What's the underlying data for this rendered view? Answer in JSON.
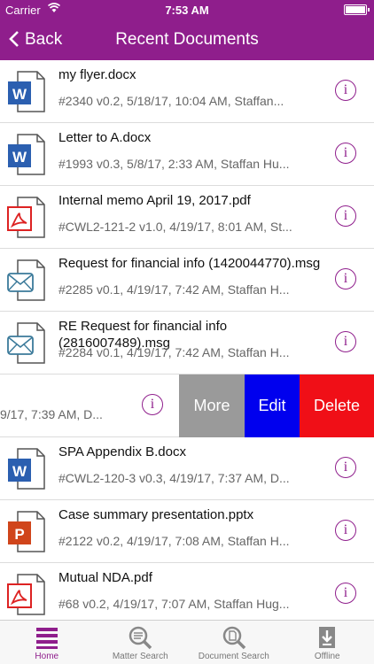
{
  "status_bar": {
    "carrier": "Carrier",
    "time": "7:53 AM"
  },
  "nav": {
    "back_label": "Back",
    "title": "Recent Documents"
  },
  "documents": [
    {
      "type": "word",
      "name": "my flyer.docx",
      "meta": "#2340 v0.2, 5/18/17, 10:04 AM,  Staffan..."
    },
    {
      "type": "word",
      "name": "Letter to A.docx",
      "meta": "#1993 v0.3, 5/8/17, 2:33 AM,  Staffan Hu..."
    },
    {
      "type": "pdf",
      "name": "Internal memo April 19, 2017.pdf",
      "meta": "#CWL2-121-2 v1.0, 4/19/17, 8:01 AM,  St..."
    },
    {
      "type": "email",
      "name": "Request for financial info (1420044770).msg",
      "meta": "#2285 v0.1, 4/19/17, 7:42 AM,  Staffan H..."
    },
    {
      "type": "email",
      "name": "RE Request for financial info (2816007489).msg",
      "meta": "#2284 v0.1, 4/19/17, 7:42 AM,  Staffan H..."
    },
    {
      "type": "swiped",
      "meta": "9/17, 7:39 AM,  D..."
    },
    {
      "type": "word",
      "name": "SPA Appendix B.docx",
      "meta": "#CWL2-120-3 v0.3, 4/19/17, 7:37 AM,  D..."
    },
    {
      "type": "ppt",
      "name": "Case summary presentation.pptx",
      "meta": "#2122 v0.2, 4/19/17, 7:08 AM,  Staffan H..."
    },
    {
      "type": "pdf",
      "name": "Mutual NDA.pdf",
      "meta": "#68 v0.2, 4/19/17, 7:07 AM,  Staffan Hug..."
    }
  ],
  "swipe_actions": {
    "more": "More",
    "edit": "Edit",
    "delete": "Delete"
  },
  "info_glyph": "i",
  "tabs": [
    {
      "label": "Home",
      "icon": "list-icon",
      "active": true
    },
    {
      "label": "Matter Search",
      "icon": "magnifier-list-icon",
      "active": false
    },
    {
      "label": "Document Search",
      "icon": "magnifier-document-icon",
      "active": false
    },
    {
      "label": "Offline",
      "icon": "download-icon",
      "active": false
    }
  ],
  "colors": {
    "brand": "#8f1e8c",
    "more": "#9a9a9a",
    "edit": "#0000ee",
    "delete": "#f00f17"
  }
}
